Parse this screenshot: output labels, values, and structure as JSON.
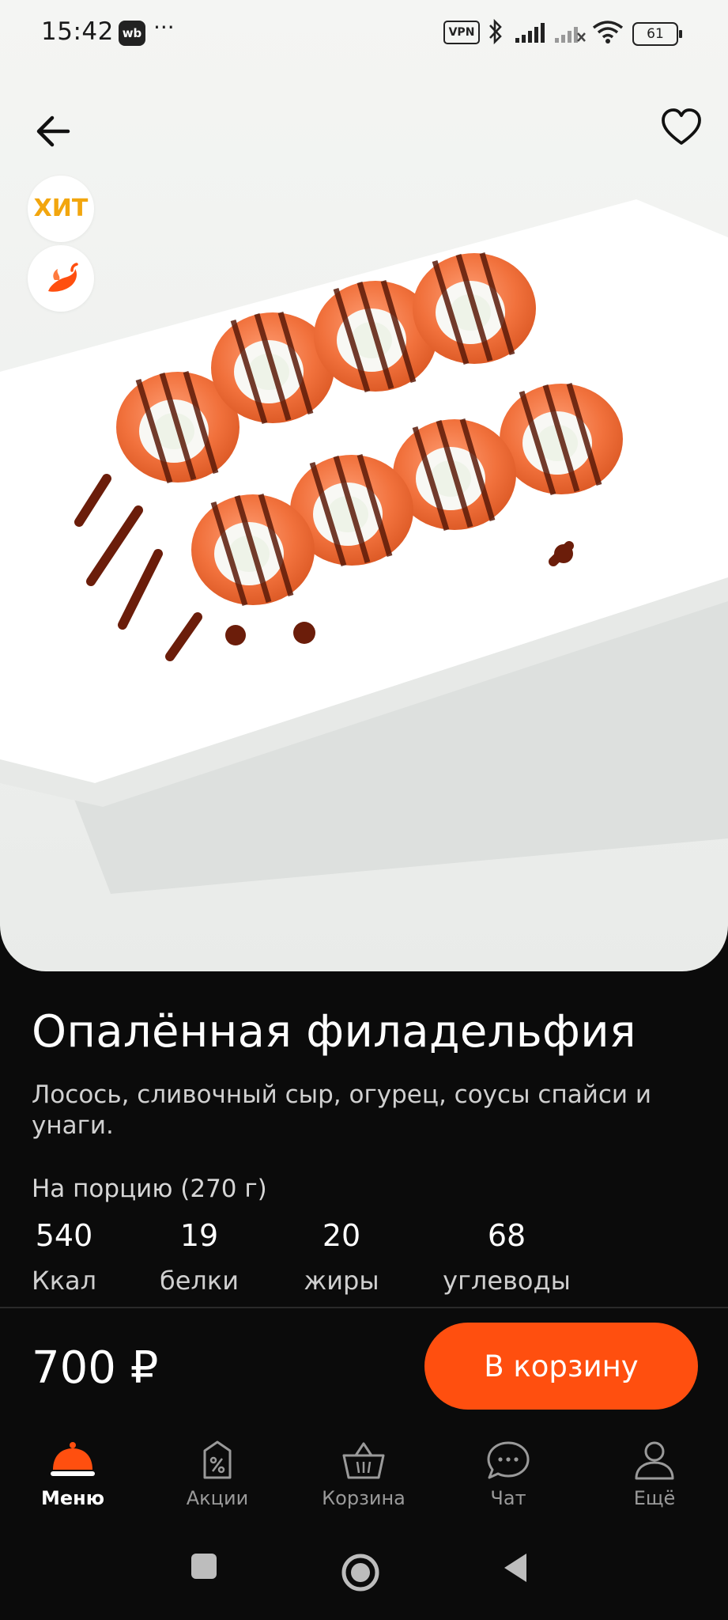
{
  "status_bar": {
    "time": "15:42",
    "app_badge": "wb",
    "overflow": "···",
    "vpn_label": "VPN",
    "battery": "61",
    "icons": [
      "bluetooth-icon",
      "signal-icon",
      "signal-off-icon",
      "wifi-icon",
      "battery-icon"
    ]
  },
  "header": {
    "back_icon": "arrow-left-icon",
    "favorite_icon": "heart-outline-icon"
  },
  "badges": {
    "hit_label": "ХИТ",
    "spicy_icon": "chili-pepper-icon"
  },
  "product": {
    "title": "Опалённая филадельфия",
    "description": "Лосось, сливочный сыр, огурец, соусы спайси и унаги.",
    "portion_label": "На порцию (270 г)",
    "nutrition": [
      {
        "value": "540",
        "label": "Ккал"
      },
      {
        "value": "19",
        "label": "белки"
      },
      {
        "value": "20",
        "label": "жиры"
      },
      {
        "value": "68",
        "label": "углеводы"
      }
    ],
    "price": "700 ₽",
    "add_to_cart_label": "В корзину"
  },
  "bottom_nav": {
    "items": [
      {
        "label": "Меню",
        "icon": "cloche-icon",
        "active": true
      },
      {
        "label": "Акции",
        "icon": "discount-tag-icon",
        "active": false
      },
      {
        "label": "Корзина",
        "icon": "basket-icon",
        "active": false
      },
      {
        "label": "Чат",
        "icon": "chat-bubble-icon",
        "active": false
      },
      {
        "label": "Ещё",
        "icon": "user-icon",
        "active": false
      }
    ]
  },
  "colors": {
    "accent": "#ff4f0f",
    "hit_badge": "#f2a60e",
    "background": "#0b0b0b"
  }
}
